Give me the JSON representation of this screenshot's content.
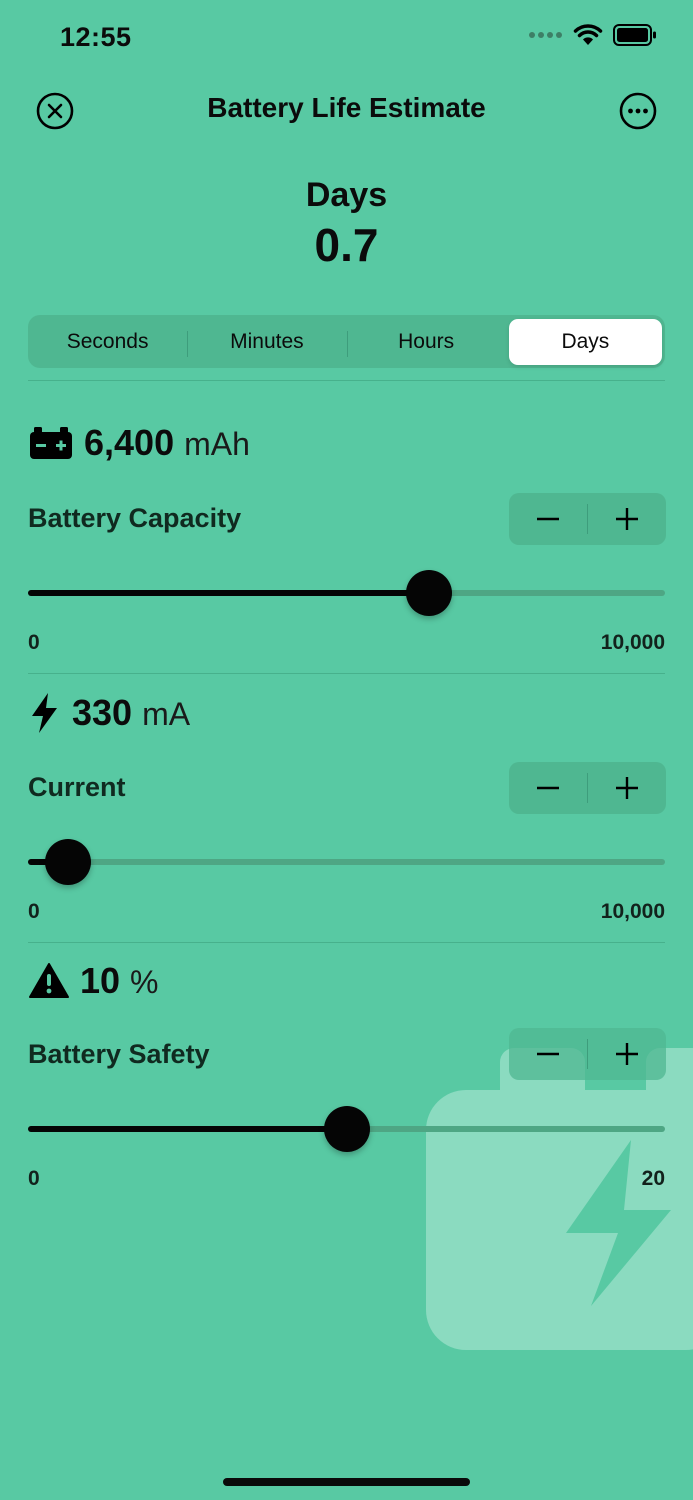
{
  "status_bar": {
    "time": "12:55"
  },
  "header": {
    "title": "Battery Life Estimate"
  },
  "result": {
    "unit_label": "Days",
    "value": "0.7"
  },
  "segments": [
    {
      "label": "Seconds",
      "active": false
    },
    {
      "label": "Minutes",
      "active": false
    },
    {
      "label": "Hours",
      "active": false
    },
    {
      "label": "Days",
      "active": true
    }
  ],
  "capacity": {
    "icon": "battery-plus-minus-icon",
    "value": "6,400",
    "unit": "mAh",
    "label": "Battery Capacity",
    "min": "0",
    "max": "10,000",
    "fraction": 0.63
  },
  "current": {
    "icon": "bolt-icon",
    "value": "330",
    "unit": "mA",
    "label": "Current",
    "min": "0",
    "max": "10,000",
    "fraction": 0.063
  },
  "safety": {
    "icon": "warning-triangle-icon",
    "value": "10",
    "unit": "%",
    "label": "Battery Safety",
    "min": "0",
    "max": "20",
    "fraction": 0.5
  },
  "colors": {
    "background": "#58c9a3",
    "accent": "#050505"
  }
}
